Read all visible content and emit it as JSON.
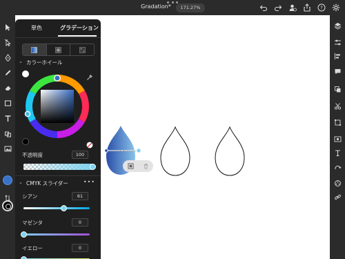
{
  "app": {
    "doc_title": "Gradation*",
    "zoom": "171.27%"
  },
  "panel": {
    "tabs": [
      {
        "label": "単色",
        "active": false
      },
      {
        "label": "グラデーション",
        "active": true
      }
    ],
    "gradient_types": [
      "linear-gradient-icon",
      "radial-gradient-icon",
      "freeform-gradient-icon"
    ],
    "color_wheel": {
      "section_label": "カラーホイール",
      "selected_hue_color": "#3a6ec4"
    },
    "opacity": {
      "label": "不透明度",
      "value": "100",
      "level_percent": 100
    },
    "cmyk": {
      "section_label": "CMYK スライダー",
      "more": "•••",
      "cyan": {
        "label": "シアン",
        "value": "61",
        "level_percent": 61
      },
      "magenta": {
        "label": "マゼンタ",
        "value": "0",
        "level_percent": 0
      },
      "yellow": {
        "label": "イエロー",
        "value": "0",
        "level_percent": 0
      }
    }
  },
  "colors": {
    "fill": "#3a72c8",
    "gradient_start": "#2a4ea8",
    "gradient_end": "#8ac4ea",
    "accent": "#7dd4f0"
  }
}
